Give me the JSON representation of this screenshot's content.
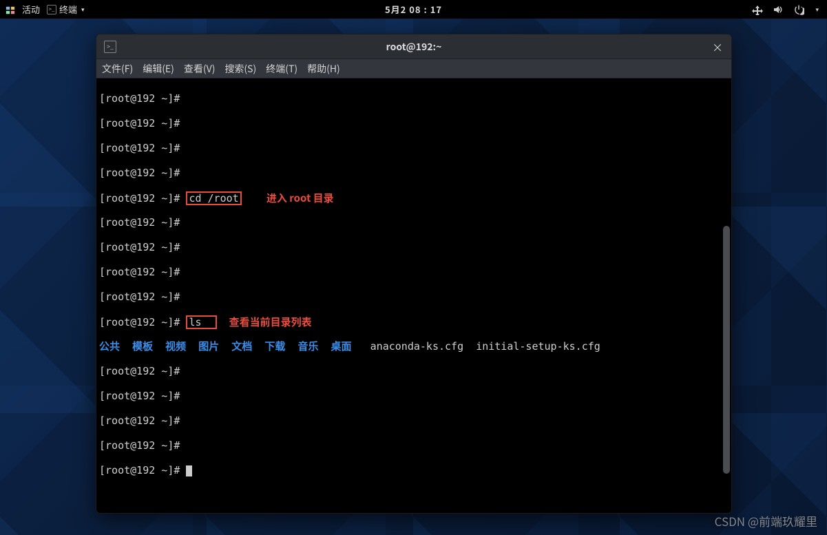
{
  "panel": {
    "activities": "活动",
    "app_name": "终端",
    "clock": "5月2 08 : 17"
  },
  "window": {
    "title": "root@192:~"
  },
  "menus": {
    "file": "文件(F)",
    "edit": "编辑(E)",
    "view": "查看(V)",
    "search": "搜索(S)",
    "terminal": "终端(T)",
    "help": "帮助(H)"
  },
  "term": {
    "prompt": "[root@192 ~]#",
    "cmd_cd": "cd /root",
    "anno_cd": "进入 root 目录",
    "cmd_ls": "ls",
    "anno_ls": "查看当前目录列表",
    "dirs": [
      "公共",
      "模板",
      "视频",
      "图片",
      "文档",
      "下载",
      "音乐",
      "桌面"
    ],
    "files": [
      "anaconda-ks.cfg",
      "initial-setup-ks.cfg"
    ]
  },
  "watermark": "CSDN @前端玖耀里"
}
